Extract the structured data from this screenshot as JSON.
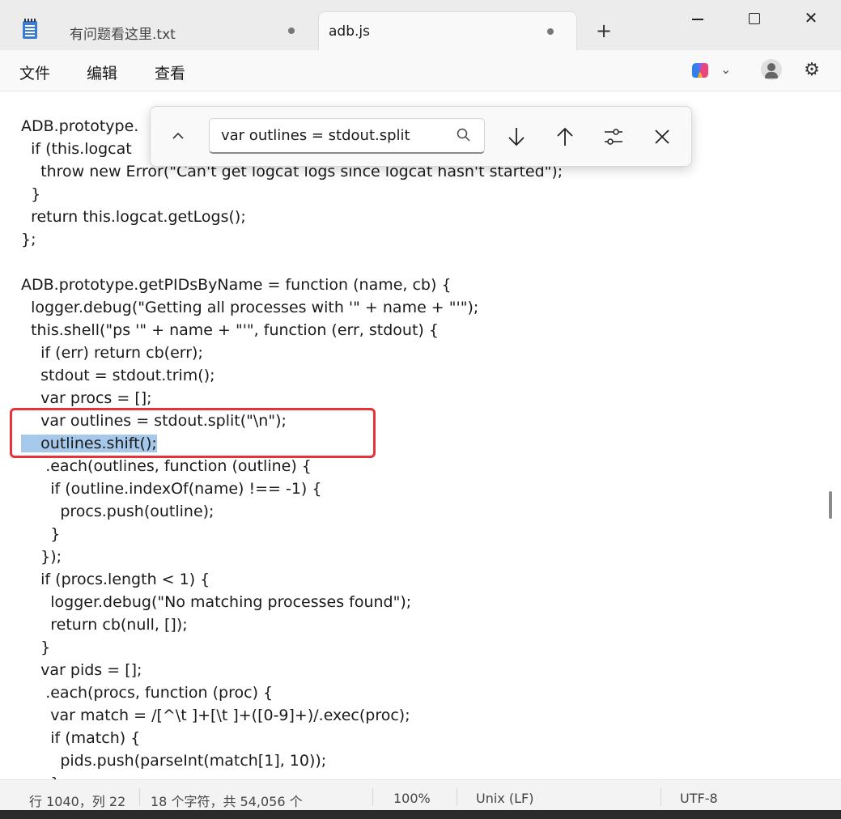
{
  "window": {
    "tabs": [
      {
        "label": "有问题看这里.txt",
        "active": false
      },
      {
        "label": "adb.js",
        "active": true
      }
    ],
    "new_tab": "+",
    "close": "✕"
  },
  "menu": {
    "file": "文件",
    "edit": "编辑",
    "view": "查看"
  },
  "find": {
    "value": "var outlines = stdout.split"
  },
  "code": [
    "ADB.prototype.",
    "  if (this.logcat ",
    "    throw new Error(\"Can't get logcat logs since logcat hasn't started\");",
    "  }",
    "  return this.logcat.getLogs();",
    "};",
    "",
    "ADB.prototype.getPIDsByName = function (name, cb) {",
    "  logger.debug(\"Getting all processes with '\" + name + \"'\");",
    "  this.shell(\"ps '\" + name + \"'\", function (err, stdout) {",
    "    if (err) return cb(err);",
    "    stdout = stdout.trim();",
    "    var procs = [];",
    "    var outlines = stdout.split(\"\\n\");",
    "    outlines.shift();",
    "     .each(outlines, function (outline) {",
    "      if (outline.indexOf(name) !== -1) {",
    "        procs.push(outline);",
    "      }",
    "    });",
    "    if (procs.length < 1) {",
    "      logger.debug(\"No matching processes found\");",
    "      return cb(null, []);",
    "    }",
    "    var pids = [];",
    "     .each(procs, function (proc) {",
    "      var match = /[^\\t ]+[\\t ]+([0-9]+)/.exec(proc);",
    "      if (match) {",
    "        pids.push(parseInt(match[1], 10));",
    "      }"
  ],
  "code_selected_line": 14,
  "status": {
    "position": "行 1040，列 22",
    "chars": "18 个字符，共 54,056 个",
    "zoom": "100%",
    "eol": "Unix (LF)",
    "encoding": "UTF-8"
  },
  "colors": {
    "selection": "#a6c8ea",
    "highlight_border": "#e6333a"
  }
}
